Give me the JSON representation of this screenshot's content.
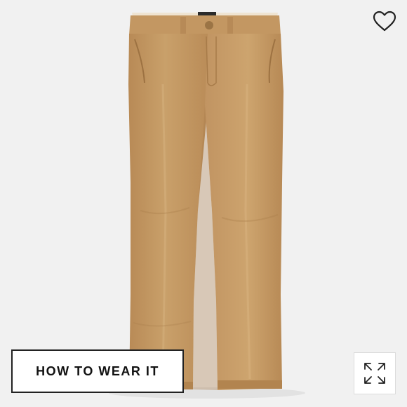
{
  "product": {
    "image_icon": "khaki-chino-pants-image",
    "fabric_color": "#c49a64",
    "background_color": "#f1f1f1"
  },
  "actions": {
    "favorite_icon": "heart-outline-icon",
    "how_to_wear_label": "HOW TO WEAR IT",
    "expand_icon": "expand-arrows-icon"
  }
}
